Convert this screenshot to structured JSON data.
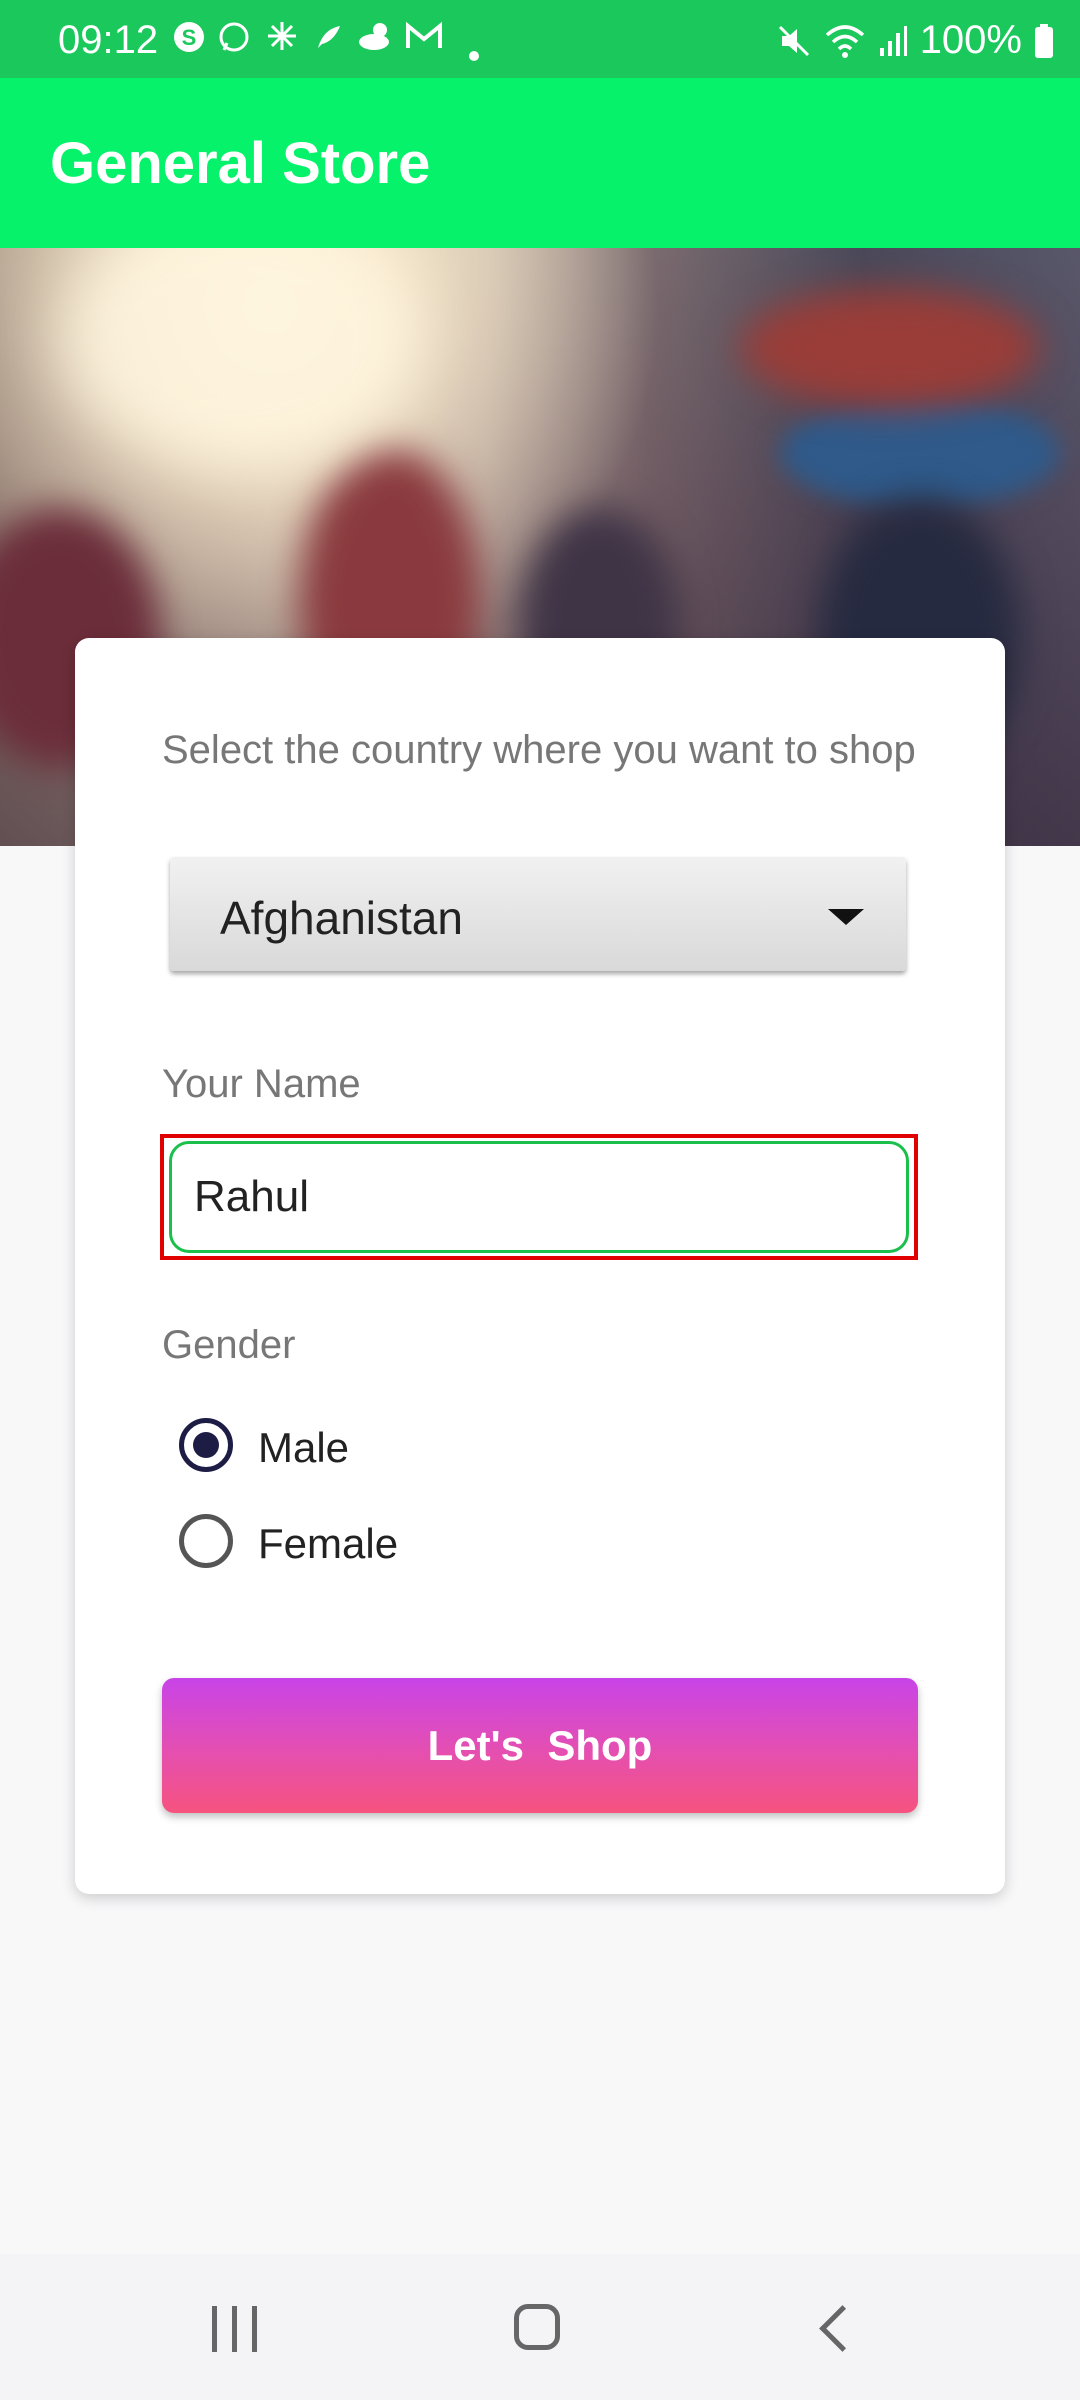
{
  "status_bar": {
    "time": "09:12",
    "battery": "100%",
    "notification_icons": [
      "skype-icon",
      "whatsapp-icon",
      "sparkle-icon",
      "leaf-icon",
      "cloud-sun-icon",
      "gmail-icon",
      "dot-icon"
    ],
    "system_icons": [
      "mute-icon",
      "wifi-icon",
      "signal-icon",
      "battery-icon"
    ]
  },
  "app_bar": {
    "title": "General Store"
  },
  "form": {
    "country_label": "Select the country where you want to shop",
    "country_selected": "Afghanistan",
    "name_label": "Your Name",
    "name_value": "Rahul",
    "gender_label": "Gender",
    "gender_options": [
      {
        "label": "Male",
        "selected": true
      },
      {
        "label": "Female",
        "selected": false
      }
    ],
    "submit_label": "Let's  Shop"
  },
  "colors": {
    "status_bar": "#1bc85c",
    "app_bar": "#05f26a",
    "button_top": "#c844e8",
    "button_bottom": "#f6537f",
    "radio_selected": "#1d1c45",
    "input_border": "#1bbf4b",
    "highlight_border": "#e00000"
  }
}
